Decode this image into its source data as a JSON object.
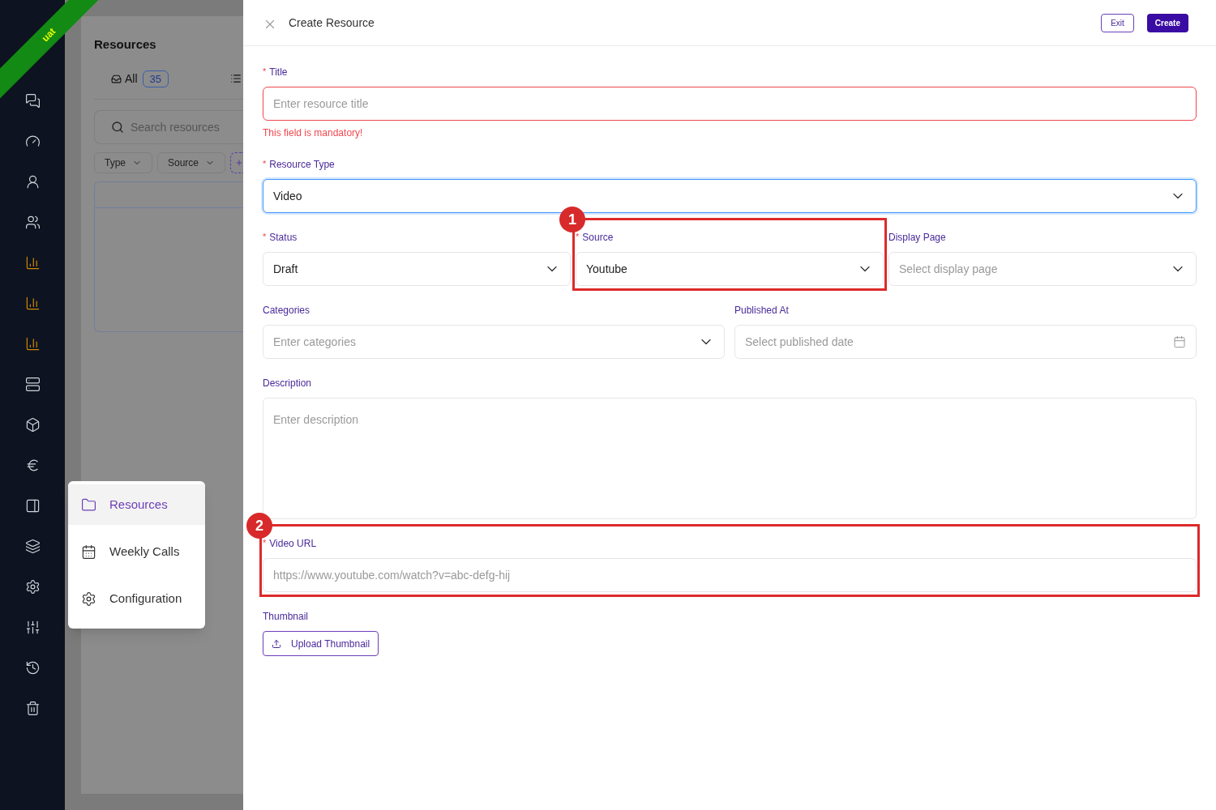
{
  "ribbon": {
    "label": "uat"
  },
  "background_page": {
    "title": "Resources",
    "tab": {
      "label": "All",
      "count": "35",
      "selected": true
    },
    "search": {
      "placeholder": "Search resources"
    },
    "filters": [
      "Type",
      "Source"
    ]
  },
  "popup_menu": [
    {
      "label": "Resources",
      "kind": "folder",
      "selected": true
    },
    {
      "label": "Weekly Calls",
      "kind": "calendar",
      "selected": false
    },
    {
      "label": "Configuration",
      "kind": "gear",
      "selected": false
    }
  ],
  "drawer": {
    "title": "Create Resource",
    "buttons": [
      {
        "label": "Exit",
        "kind": "outline"
      },
      {
        "label": "Create",
        "kind": "primary"
      }
    ],
    "rows": [
      [
        {
          "label": "Title",
          "required_mark": "*",
          "kind": "text",
          "placeholder": "Enter resource title",
          "error": "This field is mandatory!"
        }
      ],
      [
        {
          "label": "Resource Type",
          "required_mark": "*",
          "kind": "select",
          "value": "Video",
          "focused": true
        }
      ],
      [
        {
          "label": "Status",
          "required_mark": "*",
          "kind": "select",
          "value": "Draft",
          "focused": false
        },
        {
          "label": "Source",
          "required_mark": "*",
          "kind": "select",
          "value": "Youtube",
          "focused": false,
          "callout": "1"
        },
        {
          "label": "Display Page",
          "kind": "select",
          "placeholder": "Select display page",
          "focused": false
        }
      ],
      [
        {
          "label": "Categories",
          "kind": "select",
          "placeholder": "Enter categories",
          "focused": false
        },
        {
          "label": "Published At",
          "kind": "date",
          "placeholder": "Select published date",
          "focused": false
        }
      ],
      [
        {
          "label": "Description",
          "kind": "textarea",
          "placeholder": "Enter description",
          "focused": false
        }
      ],
      [
        {
          "label": "Video URL",
          "required_mark": "*",
          "kind": "text",
          "placeholder": "https://www.youtube.com/watch?v=abc-defg-hij",
          "focused": false,
          "callout": "2"
        }
      ],
      [
        {
          "label": "Thumbnail",
          "kind": "upload",
          "button": "Upload Thumbnail"
        }
      ]
    ]
  }
}
